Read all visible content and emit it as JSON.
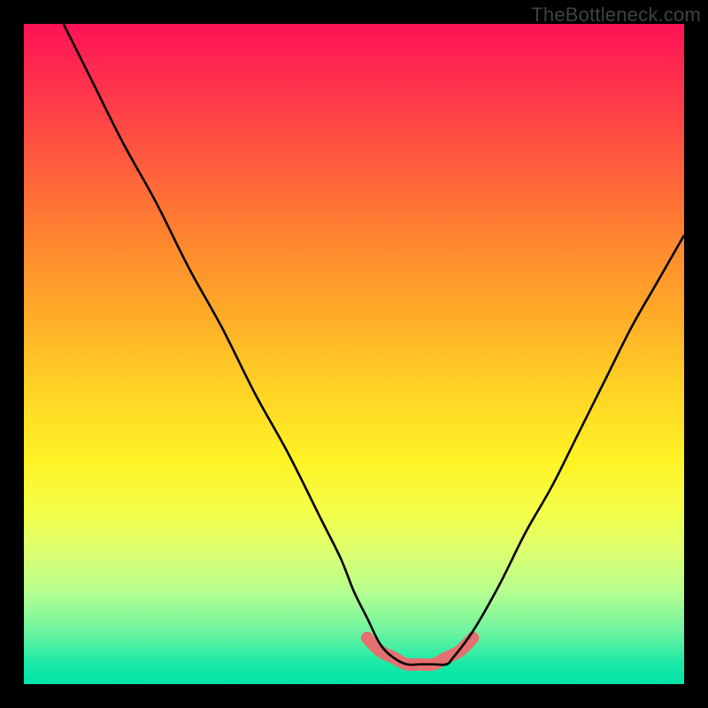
{
  "watermark": "TheBottleneck.com",
  "colors": {
    "page_bg": "#000000",
    "watermark_text": "#414141",
    "curve_stroke": "#000000",
    "accent_stroke": "#e47070",
    "gradient_stops": [
      "#ff1355",
      "#ff2e4e",
      "#ff4a44",
      "#ff6a38",
      "#ff8a2e",
      "#ffab28",
      "#ffd225",
      "#fff225",
      "#f3ff4a",
      "#dcff70",
      "#b6ff8f",
      "#6ef4a0",
      "#18e8a6",
      "#00e4aa"
    ]
  },
  "chart_data": {
    "type": "line",
    "title": "",
    "xlabel": "",
    "ylabel": "",
    "x_range": [
      0,
      100
    ],
    "y_range": [
      0,
      100
    ],
    "grid": false,
    "legend": false,
    "annotations": [],
    "notes": "No axis tick labels present; x and y in percent of frame. y=0 is bottom. Single V-shaped curve with a shallow flat trough ~x=54–65.",
    "series": [
      {
        "name": "bottleneck-curve",
        "x": [
          6,
          10,
          15,
          20,
          25,
          30,
          35,
          40,
          45,
          48,
          50,
          52,
          54,
          56,
          58,
          60,
          62,
          64,
          65,
          68,
          72,
          76,
          80,
          84,
          88,
          92,
          96,
          100
        ],
        "y": [
          100,
          92,
          82,
          73,
          63,
          54,
          44,
          35,
          25,
          19,
          14,
          10,
          6,
          4,
          3,
          3,
          3,
          3,
          4,
          8,
          15,
          23,
          30,
          38,
          46,
          54,
          61,
          68
        ]
      }
    ],
    "trough_accent": {
      "name": "accent-cap",
      "x": [
        52,
        54,
        56,
        58,
        60,
        62,
        64,
        66,
        68
      ],
      "y": [
        7,
        5,
        4,
        3,
        3,
        3,
        4,
        5,
        7
      ],
      "stroke": "#e47070",
      "stroke_width_px": 14
    }
  }
}
